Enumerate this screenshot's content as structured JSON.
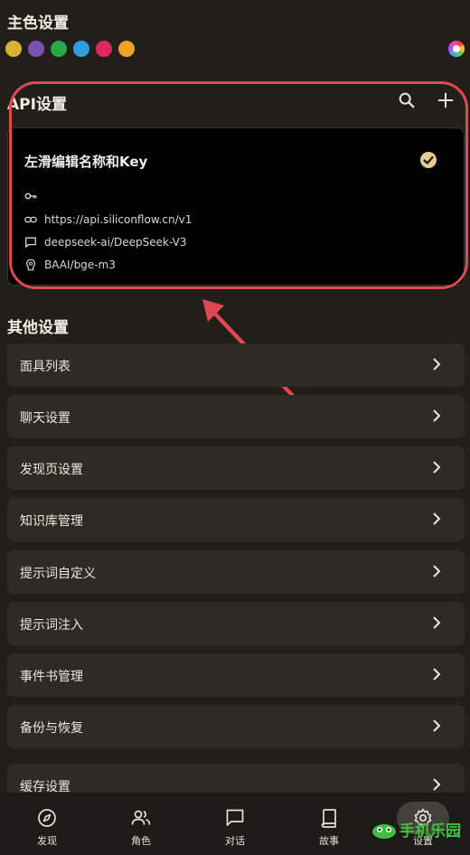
{
  "theme": {
    "title": "主色设置",
    "swatches": [
      "#d7b234",
      "#7a51b5",
      "#2aa84a",
      "#2f9fe0",
      "#e0285e",
      "#f0a224"
    ],
    "palette_icon": "color-palette-icon"
  },
  "api": {
    "title": "API设置",
    "search_icon": "search-icon",
    "add_icon": "plus-icon",
    "card": {
      "title": "左滑编辑名称和Key",
      "selected": true,
      "key": "",
      "url": "https://api.siliconflow.cn/v1",
      "chat_model": "deepseek-ai/DeepSeek-V3",
      "embedding_model": "BAAI/bge-m3"
    }
  },
  "other": {
    "title": "其他设置",
    "items": [
      {
        "label": "面具列表"
      },
      {
        "label": "聊天设置"
      },
      {
        "label": "发现页设置"
      },
      {
        "label": "知识库管理"
      },
      {
        "label": "提示词自定义"
      },
      {
        "label": "提示词注入"
      },
      {
        "label": "事件书管理"
      },
      {
        "label": "备份与恢复"
      },
      {
        "label": "缓存设置"
      }
    ]
  },
  "nav": {
    "items": [
      {
        "label": "发现",
        "icon": "compass-icon"
      },
      {
        "label": "角色",
        "icon": "people-icon"
      },
      {
        "label": "对话",
        "icon": "chat-bubble-icon"
      },
      {
        "label": "故事",
        "icon": "book-icon"
      },
      {
        "label": "设置",
        "icon": "gear-icon",
        "active": true
      }
    ]
  },
  "watermark": {
    "text": "手机乐园"
  },
  "colors": {
    "accent": "#e3cd92",
    "highlight": "#e0484f",
    "background": "#221f1b",
    "card": "#2e2a25"
  }
}
